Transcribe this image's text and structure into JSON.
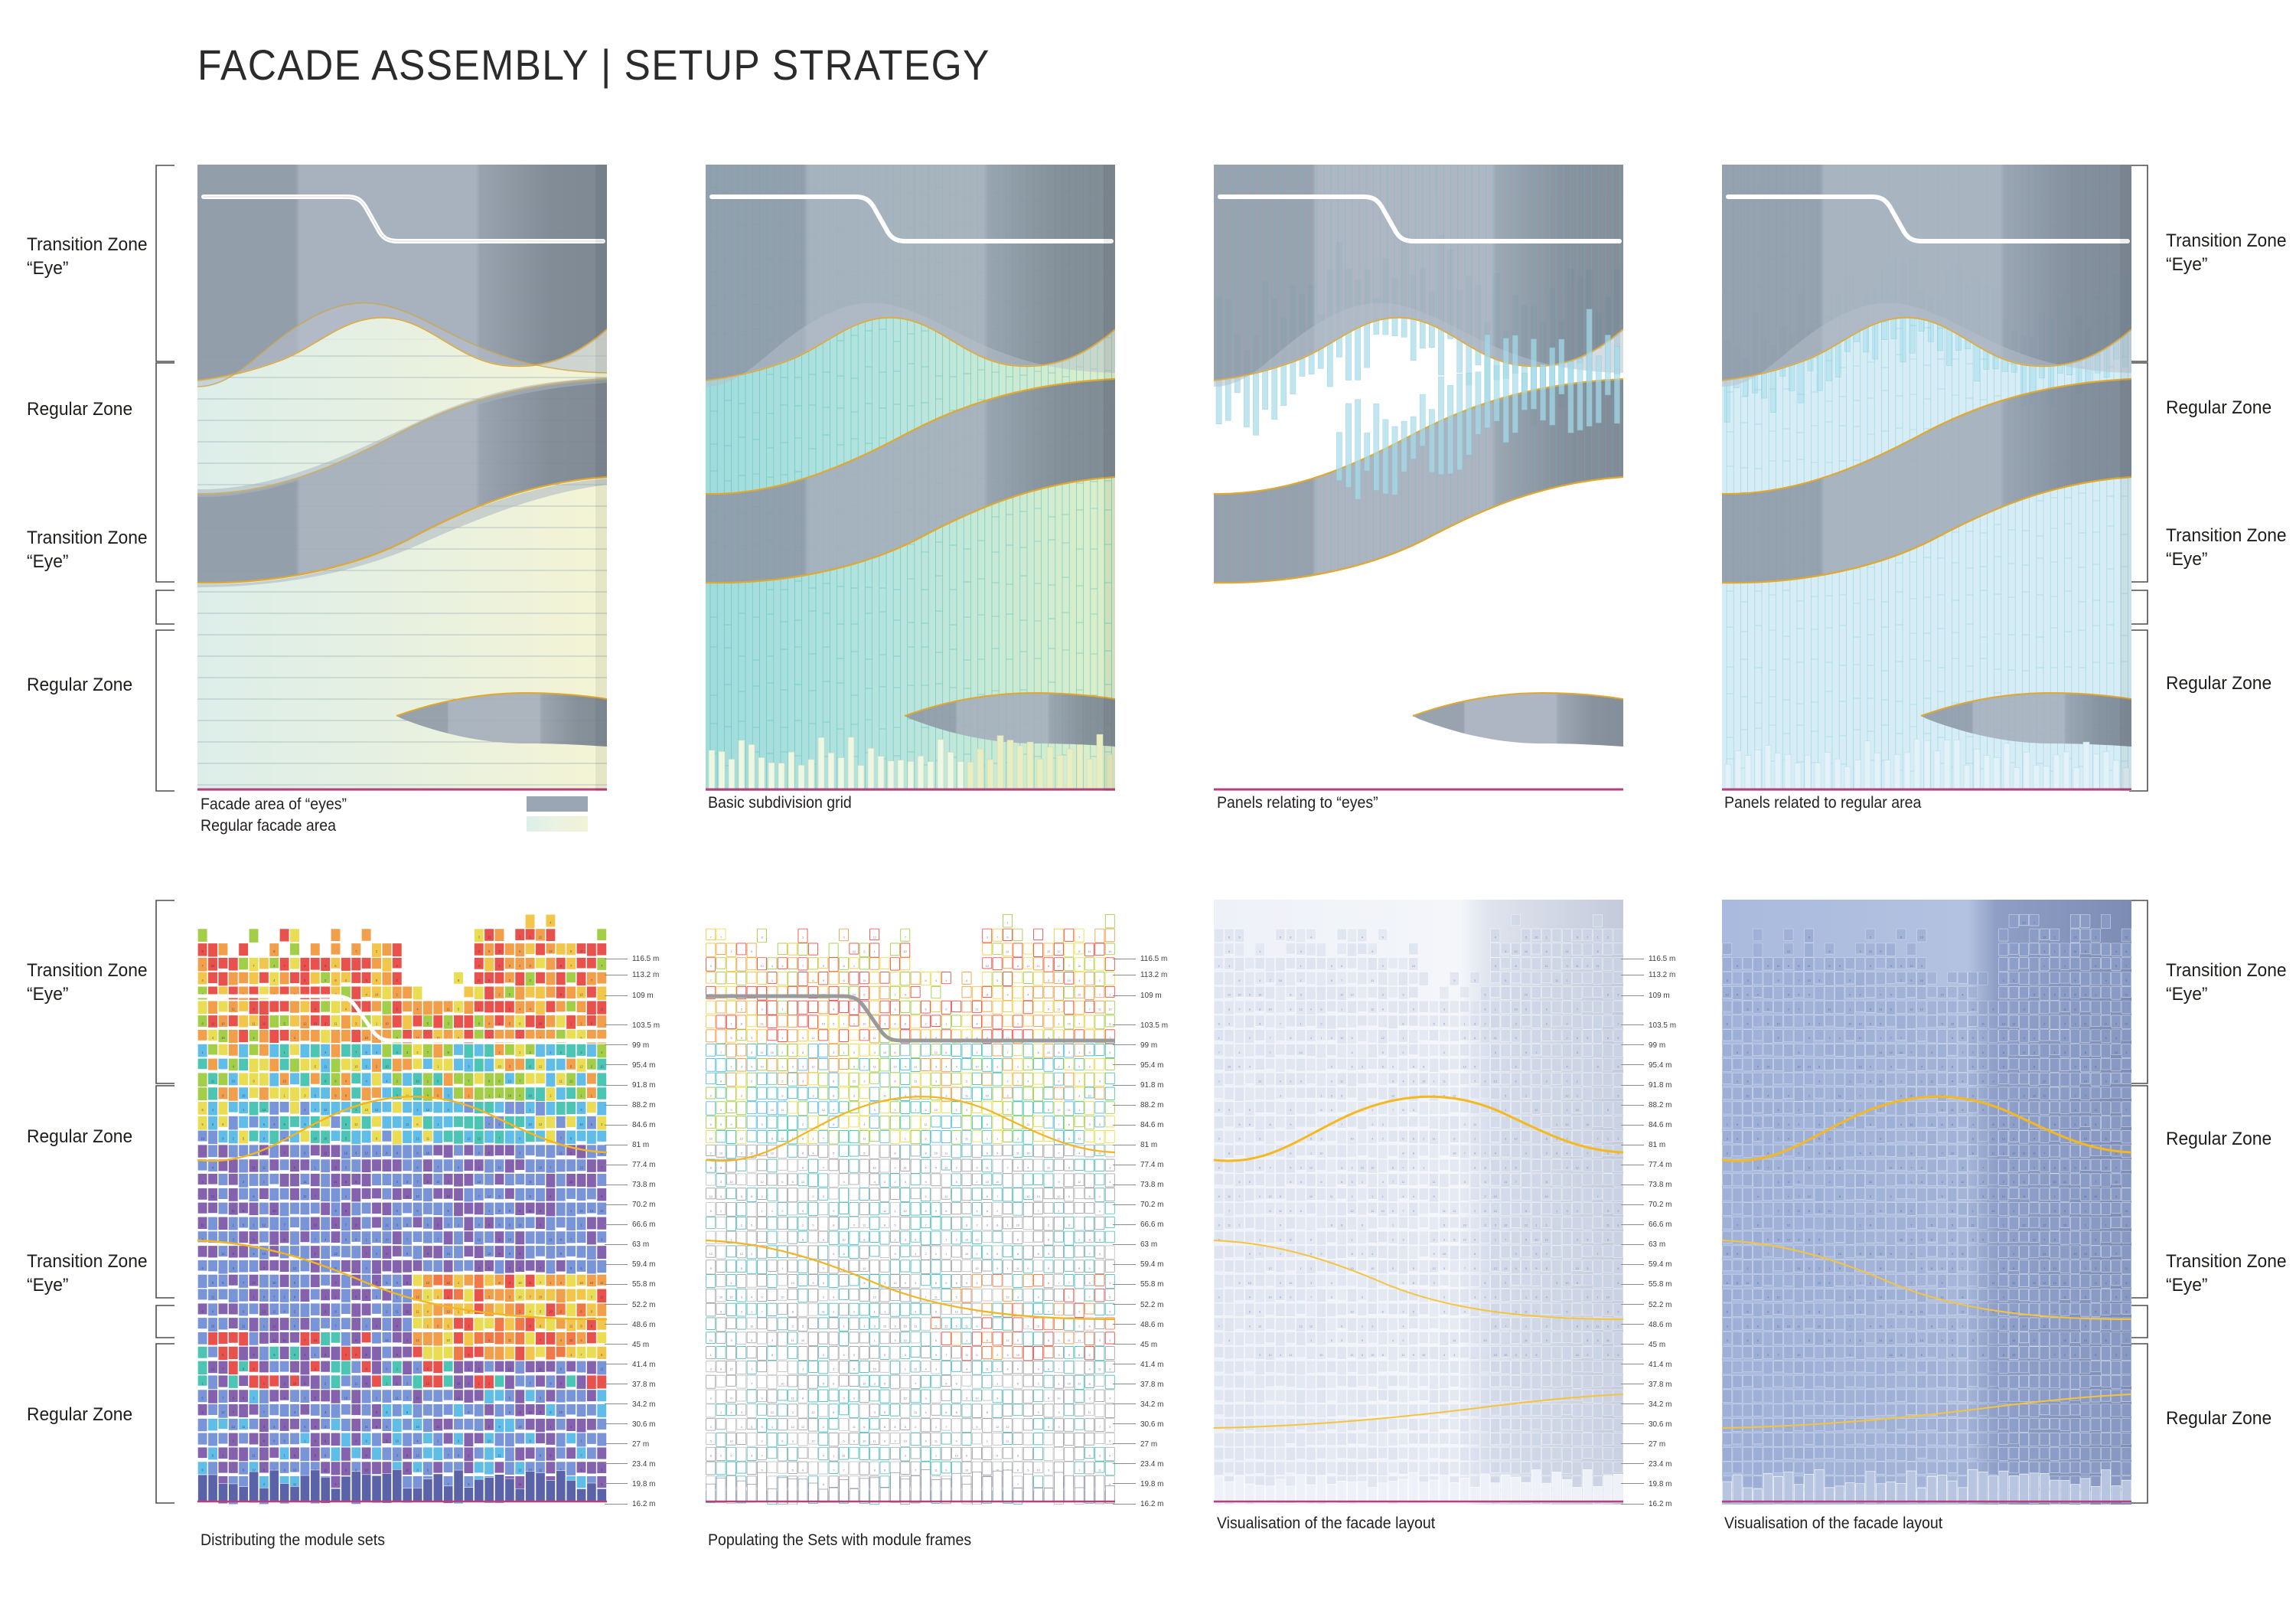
{
  "title": "FACADE ASSEMBLY | SETUP STRATEGY",
  "zones_left": [
    {
      "label": "Transition Zone\n“Eye”"
    },
    {
      "label": "Regular Zone"
    },
    {
      "label": "Transition Zone\n“Eye”"
    },
    {
      "label": "Regular Zone"
    }
  ],
  "zones_right": [
    {
      "label": "Transition Zone\n“Eye”"
    },
    {
      "label": "Regular Zone"
    },
    {
      "label": "Transition Zone\n“Eye”"
    },
    {
      "label": "Regular Zone"
    }
  ],
  "zones_left_bottom": [
    {
      "label": "Transition Zone\n“Eye”"
    },
    {
      "label": "Regular Zone"
    },
    {
      "label": "Transition Zone\n“Eye”"
    },
    {
      "label": "Regular Zone"
    }
  ],
  "zones_right_bottom": [
    {
      "label": "Transition Zone\n“Eye”"
    },
    {
      "label": "Regular Zone"
    },
    {
      "label": "Transition Zone\n“Eye”"
    },
    {
      "label": "Regular Zone"
    }
  ],
  "legend": {
    "lines": "Facade area of “eyes”\nRegular facade area",
    "eye_label": "Facade area of “eyes”",
    "regular_label": "Regular facade area",
    "eye_color": "#9aa6b4",
    "regular_color": "#e4eedf"
  },
  "boards": [
    {
      "id": "board-1",
      "caption": ""
    },
    {
      "id": "board-2",
      "caption": "Basic subdivision grid"
    },
    {
      "id": "board-3",
      "caption": "Panels relating to “eyes”"
    },
    {
      "id": "board-4",
      "caption": "Panels related to regular area"
    },
    {
      "id": "board-5",
      "caption": "Distributing the module sets"
    },
    {
      "id": "board-6",
      "caption": "Populating the Sets with module frames"
    },
    {
      "id": "board-7",
      "caption": "Visualisation of the facade layout"
    },
    {
      "id": "board-8",
      "caption": "Visualisation of the facade layout"
    }
  ],
  "elevations": [
    "116.5 m",
    "113.2 m",
    "109 m",
    "103.5 m",
    "99 m",
    "95.4 m",
    "91.8 m",
    "88.2 m",
    "84.6 m",
    "81 m",
    "77.4 m",
    "73.8 m",
    "70.2 m",
    "66.6 m",
    "63 m",
    "59.4 m",
    "55.8 m",
    "52.2 m",
    "48.6 m",
    "45 m",
    "41.4 m",
    "37.8 m",
    "34.2 m",
    "30.6 m",
    "27 m",
    "23.4 m",
    "19.8 m",
    "16.2 m"
  ],
  "colors": {
    "eye_fill": "#9aa6b4",
    "eye_fill_dark": "#7d8894",
    "regular_gradient_start": "#dff0ea",
    "regular_gradient_end": "#f2f3d4",
    "boundary_curve": "#e0a82e",
    "teal_grid": "#66c3c0",
    "panel_blue": "#a8dcea",
    "roof_line": "#ffffff",
    "base_line": "#b5427f",
    "module_red": "#e8443f",
    "module_orange": "#f0983e",
    "module_yellow": "#eadb46",
    "module_green": "#9ccb3b",
    "module_teal": "#3fc1b0",
    "module_cyan": "#55b9e6",
    "module_blue": "#6f8ed4",
    "module_purple": "#7b57a8",
    "viz_blue": "#93a8d0"
  },
  "module_numbers": [
    "1",
    "2",
    "3",
    "4",
    "5",
    "6",
    "7",
    "8",
    "9",
    "10",
    "11",
    "12"
  ]
}
